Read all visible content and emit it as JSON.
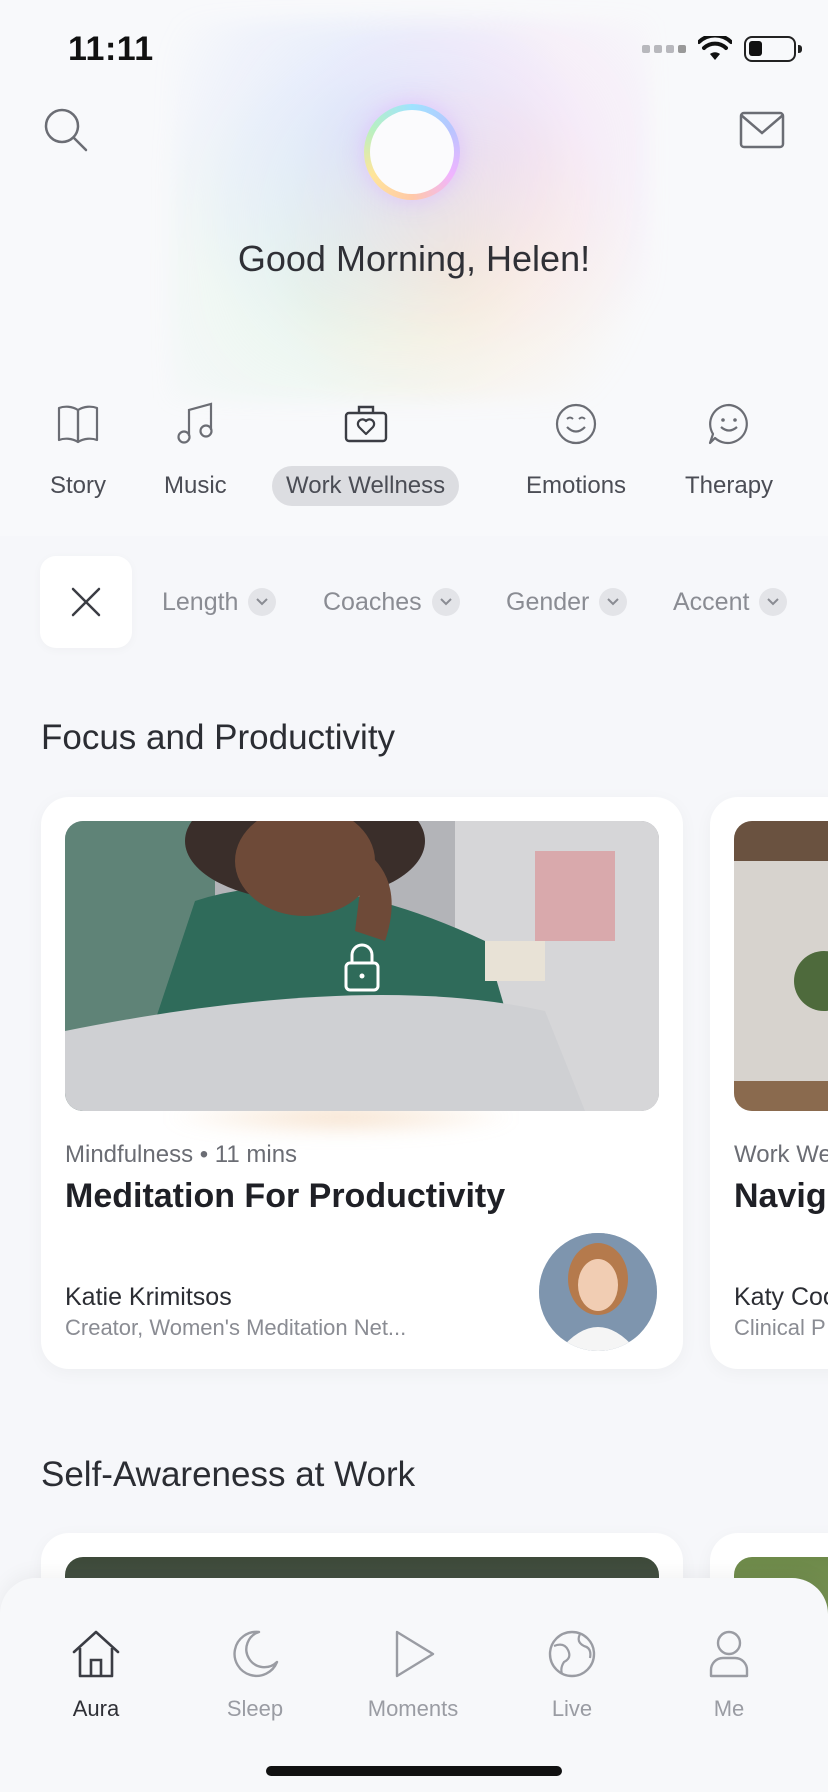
{
  "status_bar": {
    "time": "11:11"
  },
  "header": {
    "greeting": "Good Morning, Helen!"
  },
  "categories": [
    {
      "label": "Story",
      "icon": "book-icon"
    },
    {
      "label": "Music",
      "icon": "music-note-icon"
    },
    {
      "label": "Work Wellness",
      "icon": "briefcase-heart-icon",
      "active": true
    },
    {
      "label": "Emotions",
      "icon": "smiley-icon"
    },
    {
      "label": "Therapy",
      "icon": "chat-smiley-icon"
    }
  ],
  "filters": {
    "chips": [
      "Length",
      "Coaches",
      "Gender",
      "Accent"
    ]
  },
  "sections": [
    {
      "title": "Focus and Productivity",
      "cards": [
        {
          "meta": "Mindfulness • 11 mins",
          "title": "Meditation For Productivity",
          "coach_name": "Katie Krimitsos",
          "coach_role": "Creator, Women's Meditation Net...",
          "locked": true
        },
        {
          "meta": "Work We",
          "title": "Navig",
          "coach_name": "Katy Coo",
          "coach_role": "Clinical P"
        }
      ]
    },
    {
      "title": "Self-Awareness at Work"
    }
  ],
  "tabbar": {
    "tabs": [
      {
        "label": "Aura",
        "icon": "home-icon",
        "active": true
      },
      {
        "label": "Sleep",
        "icon": "moon-icon"
      },
      {
        "label": "Moments",
        "icon": "play-icon"
      },
      {
        "label": "Live",
        "icon": "globe-icon"
      },
      {
        "label": "Me",
        "icon": "person-icon"
      }
    ]
  },
  "colors": {
    "background": "#f6f7fa",
    "text": "#2b2d33",
    "muted": "#8a8c93",
    "active_pill": "#dcdde1"
  }
}
